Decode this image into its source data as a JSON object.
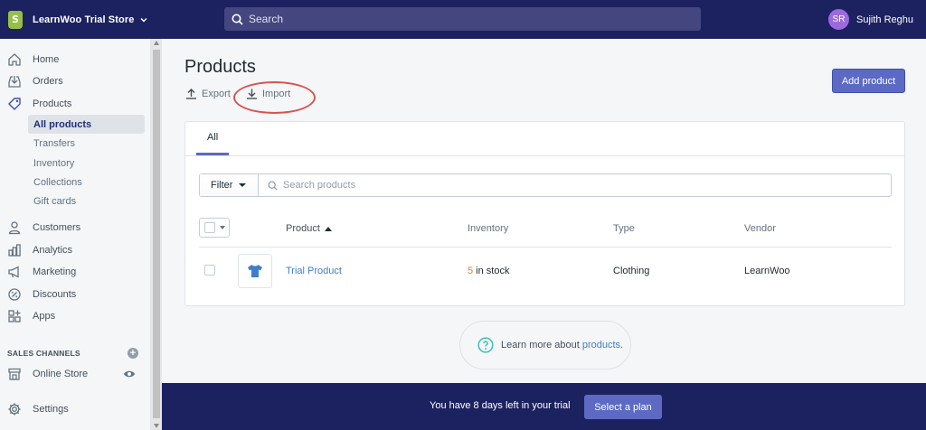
{
  "topbar": {
    "store_name": "LearnWoo Trial Store",
    "search_placeholder": "Search",
    "user_initials": "SR",
    "user_name": "Sujith Reghu",
    "colors": {
      "bar": "#1c2260",
      "avatar": "#9c6ade",
      "logo": "#95bf47"
    }
  },
  "sidebar": {
    "items": [
      {
        "label": "Home",
        "icon": "home-icon"
      },
      {
        "label": "Orders",
        "icon": "orders-icon"
      },
      {
        "label": "Products",
        "icon": "tag-icon"
      },
      {
        "label": "Customers",
        "icon": "person-icon"
      },
      {
        "label": "Analytics",
        "icon": "bar-chart-icon"
      },
      {
        "label": "Marketing",
        "icon": "megaphone-icon"
      },
      {
        "label": "Discounts",
        "icon": "discount-icon"
      },
      {
        "label": "Apps",
        "icon": "apps-icon"
      }
    ],
    "product_subitems": [
      {
        "label": "All products",
        "active": true
      },
      {
        "label": "Transfers"
      },
      {
        "label": "Inventory"
      },
      {
        "label": "Collections"
      },
      {
        "label": "Gift cards"
      }
    ],
    "sales_channels_heading": "SALES CHANNELS",
    "online_store": "Online Store",
    "settings": "Settings"
  },
  "main": {
    "title": "Products",
    "export_label": "Export",
    "import_label": "Import",
    "add_product_label": "Add product",
    "tabs": [
      {
        "label": "All",
        "selected": true
      }
    ],
    "filter_label": "Filter",
    "search_placeholder": "Search products",
    "columns": {
      "product": "Product",
      "inventory": "Inventory",
      "type": "Type",
      "vendor": "Vendor"
    },
    "rows": [
      {
        "product": "Trial Product",
        "stock_count": "5",
        "stock_suffix": " in stock",
        "type": "Clothing",
        "vendor": "LearnWoo"
      }
    ],
    "learn_text": "Learn more about",
    "learn_link": "products."
  },
  "trial": {
    "message": "You have 8 days left in your trial",
    "button": "Select a plan"
  },
  "colors": {
    "accent": "#5c6ac4",
    "link": "#3f7fc3",
    "stock": "#e67e22",
    "annotation": "#d9534f"
  }
}
